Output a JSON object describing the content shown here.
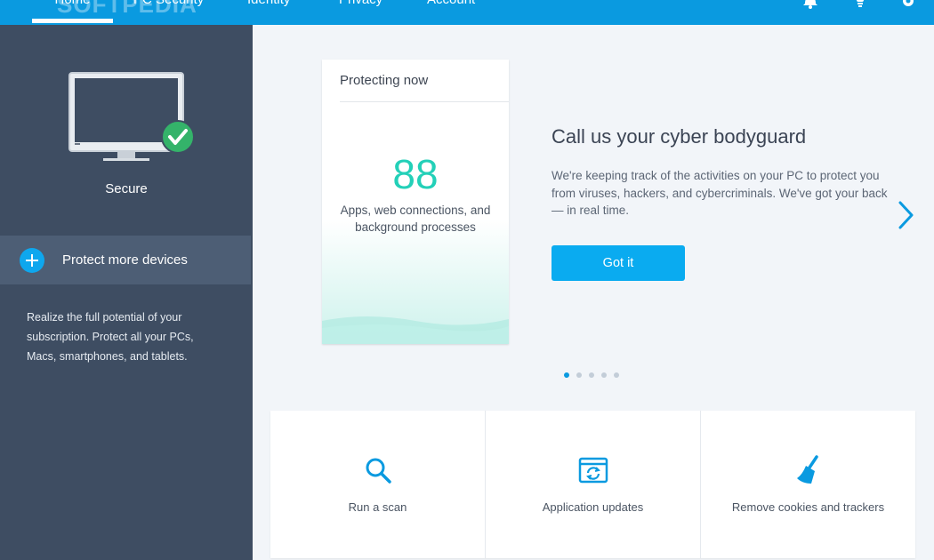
{
  "nav": {
    "items": [
      {
        "label": "Home"
      },
      {
        "label": "PC Security"
      },
      {
        "label": "Identity"
      },
      {
        "label": "Privacy"
      },
      {
        "label": "Account"
      }
    ],
    "watermark": "SOFTPEDIA"
  },
  "sidebar": {
    "status_label": "Secure",
    "protect_label": "Protect more devices",
    "description": "Realize the full potential of your subscription. Protect all your PCs, Macs, smartphones, and tablets."
  },
  "carousel": {
    "card": {
      "title": "Protecting now",
      "number": "88",
      "description": "Apps, web connections, and background processes"
    },
    "headline": "Call us your cyber bodyguard",
    "body": "We're keeping track of the activities on your PC to protect you from viruses, hackers, and cybercriminals. We've got your back — in real time.",
    "button_label": "Got it",
    "page_count": 5,
    "active_page": 1
  },
  "tiles": [
    {
      "label": "Run a scan",
      "icon": "search-icon"
    },
    {
      "label": "Application updates",
      "icon": "app-update-icon"
    },
    {
      "label": "Remove cookies and trackers",
      "icon": "broom-icon"
    }
  ],
  "colors": {
    "accent": "#0a9ae0",
    "button": "#0aabf0",
    "sidebar": "#3e4d62",
    "counter": "#23d0b8",
    "check": "#34b36a"
  }
}
